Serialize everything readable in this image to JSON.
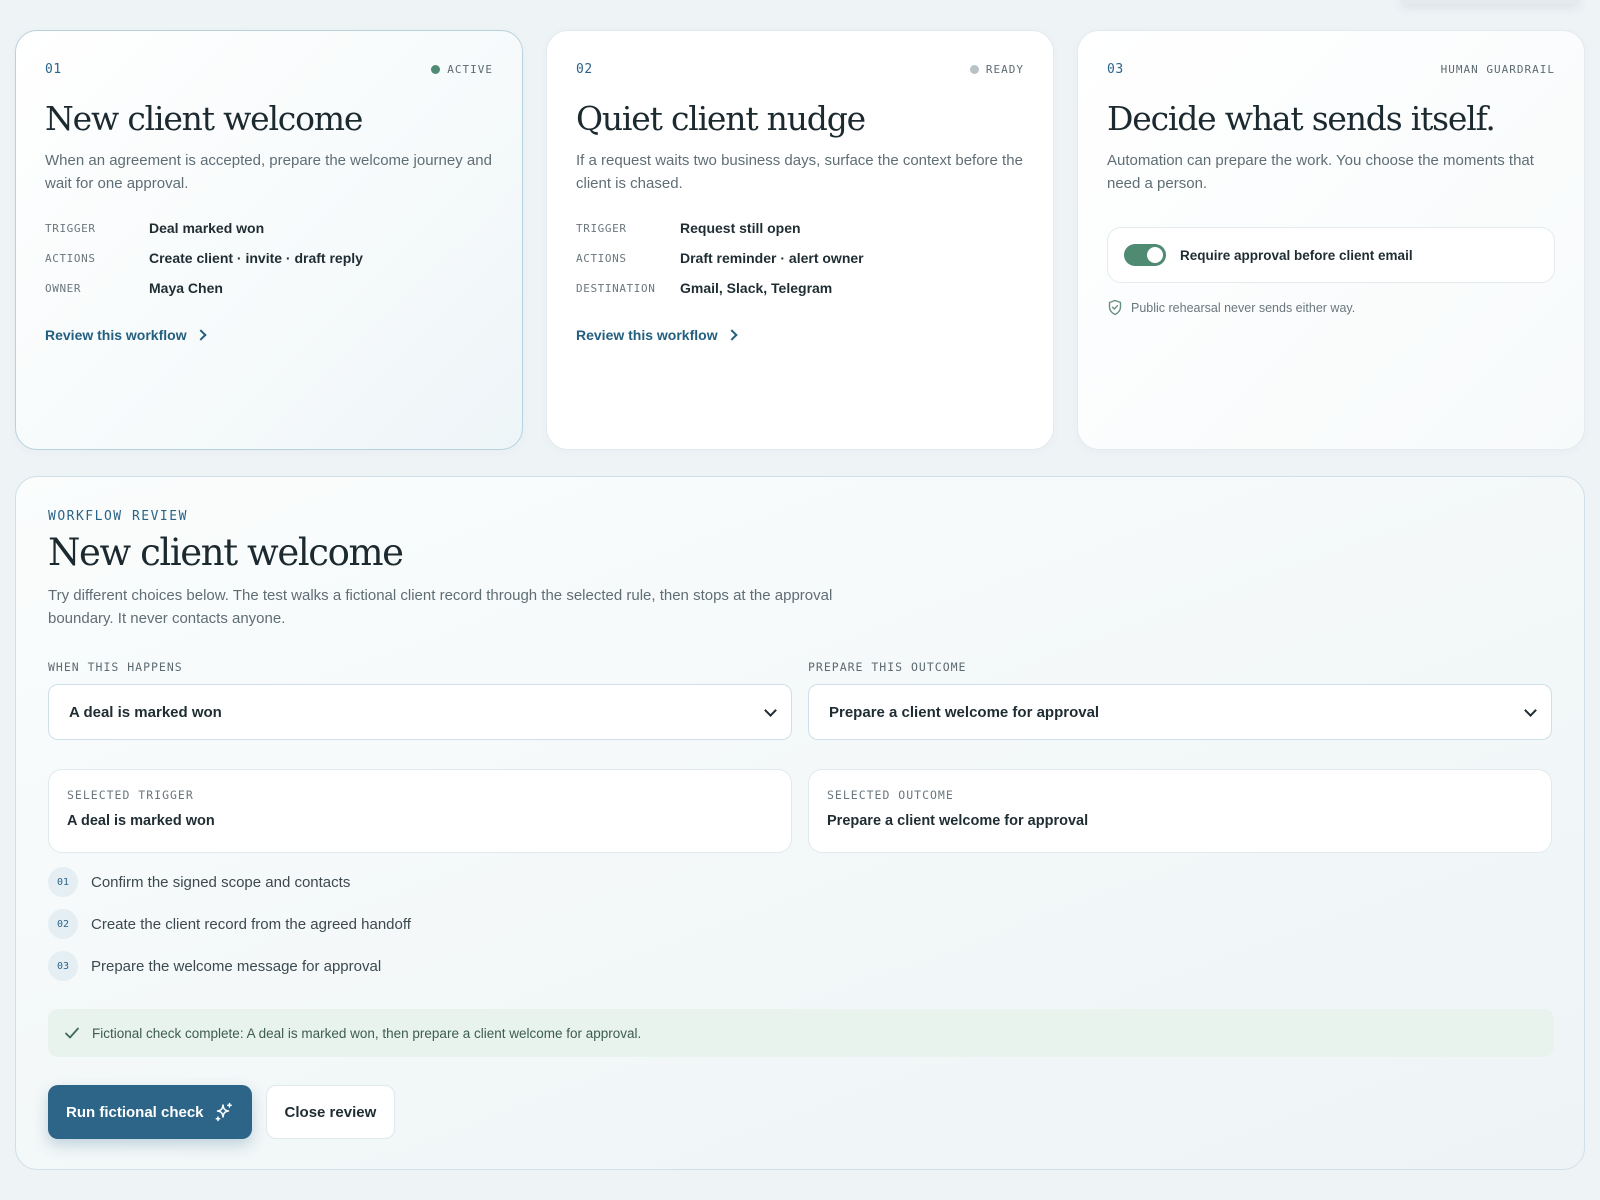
{
  "cards": [
    {
      "num": "01",
      "status": "ACTIVE",
      "title": "New client welcome",
      "desc": "When an agreement is accepted, prepare the welcome journey and wait for one approval.",
      "rows": [
        {
          "key": "TRIGGER",
          "val": "Deal marked won"
        },
        {
          "key": "ACTIONS",
          "val": "Create client · invite · draft reply"
        },
        {
          "key": "OWNER",
          "val": "Maya Chen"
        }
      ],
      "link": "Review this workflow"
    },
    {
      "num": "02",
      "status": "READY",
      "title": "Quiet client nudge",
      "desc": "If a request waits two business days, surface the context before the client is chased.",
      "rows": [
        {
          "key": "TRIGGER",
          "val": "Request still open"
        },
        {
          "key": "ACTIONS",
          "val": "Draft reminder · alert owner"
        },
        {
          "key": "DESTINATION",
          "val": "Gmail, Slack, Telegram"
        }
      ],
      "link": "Review this workflow"
    },
    {
      "num": "03",
      "status": "HUMAN GUARDRAIL",
      "title": "Decide what sends itself.",
      "desc": "Automation can prepare the work. You choose the moments that need a person.",
      "toggle_label": "Require approval before client email",
      "toggle_on": true,
      "note": "Public rehearsal never sends either way."
    }
  ],
  "review": {
    "eyebrow": "WORKFLOW REVIEW",
    "title": "New client welcome",
    "desc": "Try different choices below. The test walks a fictional client record through the selected rule, then stops at the approval boundary. It never contacts anyone.",
    "when_label": "WHEN THIS HAPPENS",
    "when_value": "A deal is marked won",
    "prepare_label": "PREPARE THIS OUTCOME",
    "prepare_value": "Prepare a client welcome for approval",
    "selected_trigger_label": "SELECTED TRIGGER",
    "selected_trigger": "A deal is marked won",
    "selected_outcome_label": "SELECTED OUTCOME",
    "selected_outcome": "Prepare a client welcome for approval",
    "steps": [
      {
        "num": "01",
        "text": "Confirm the signed scope and contacts"
      },
      {
        "num": "02",
        "text": "Create the client record from the agreed handoff"
      },
      {
        "num": "03",
        "text": "Prepare the welcome message for approval"
      }
    ],
    "success": "Fictional check complete: A deal is marked won, then prepare a client welcome for approval.",
    "run_button": "Run fictional check",
    "close_button": "Close review"
  },
  "colors": {
    "accent": "#2c6587",
    "active_dot": "#4f8a73",
    "ready_dot": "#b8c2c7",
    "success_bg": "#e8f3ee"
  },
  "icons": {
    "link": "chevron-right-icon",
    "select": "chevron-down-icon",
    "note": "shield-check-icon",
    "success": "check-icon",
    "run": "sparkles-icon"
  }
}
